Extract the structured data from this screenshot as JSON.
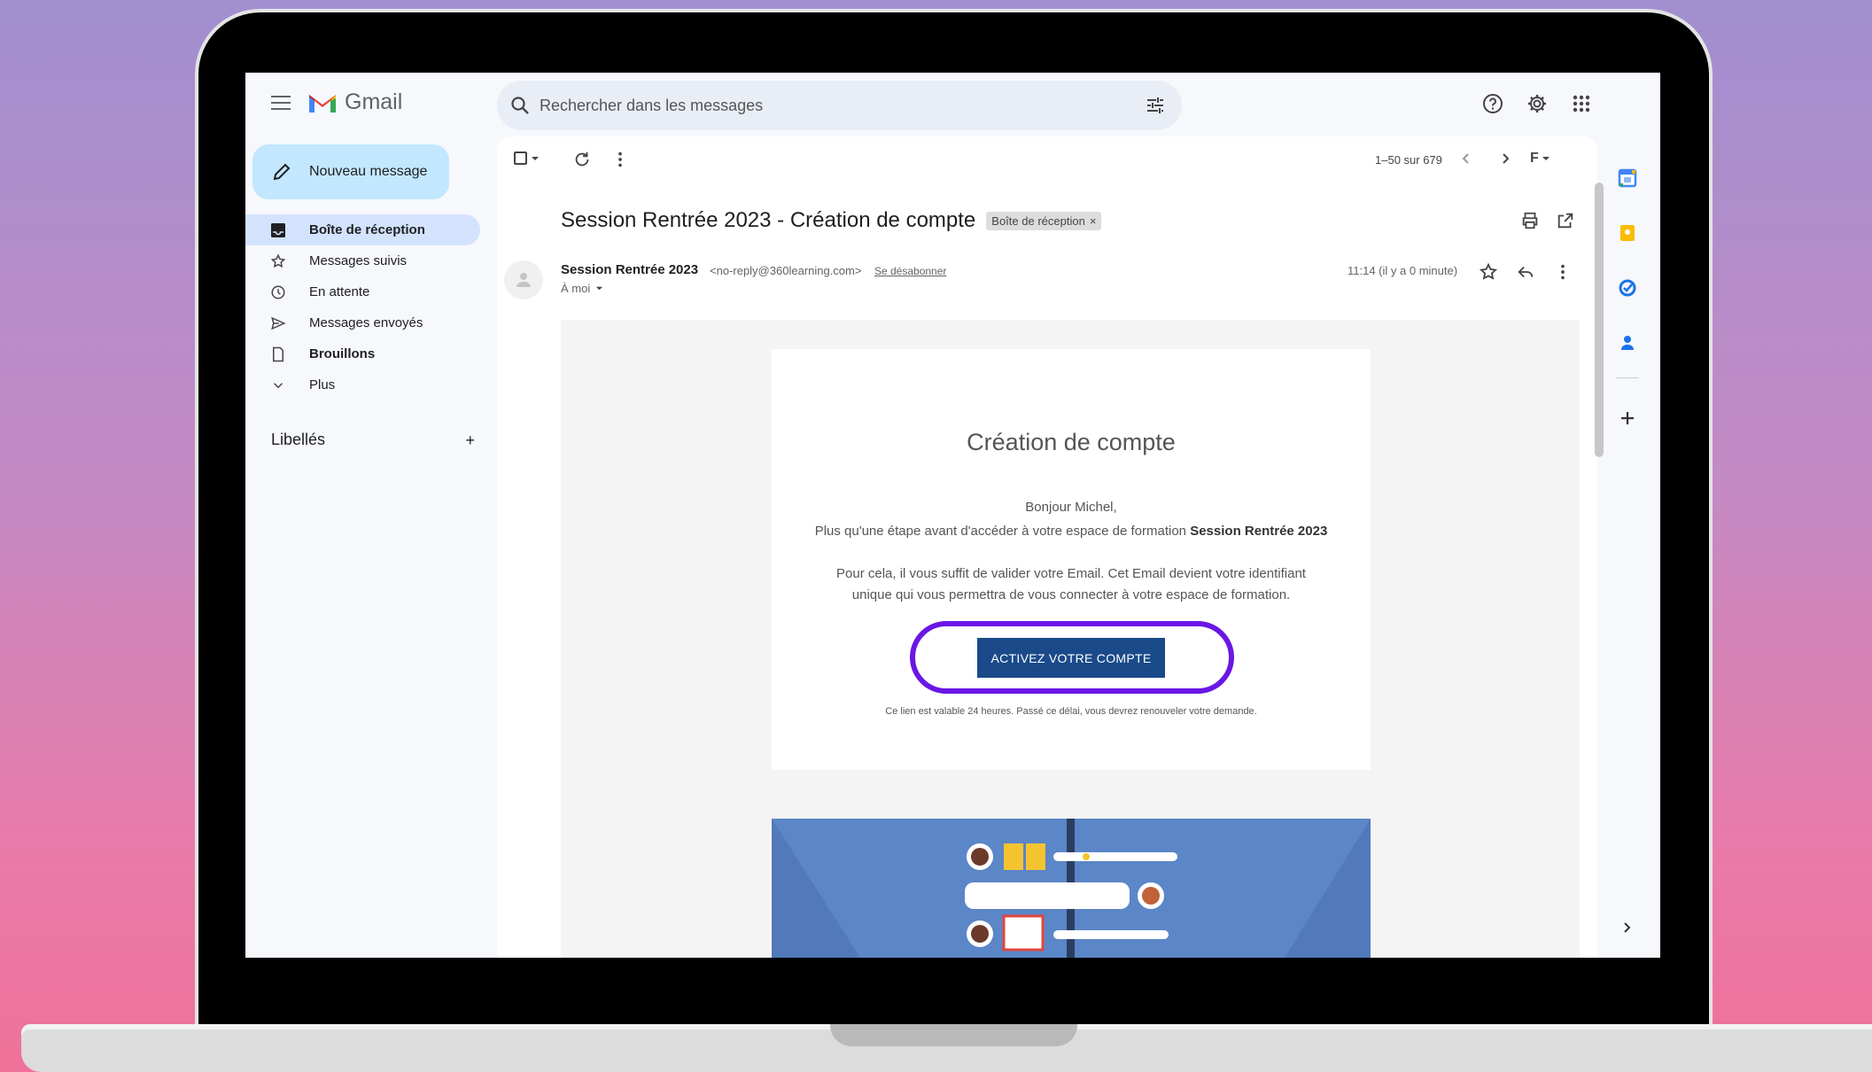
{
  "app": {
    "name": "Gmail"
  },
  "search": {
    "placeholder": "Rechercher dans les messages"
  },
  "compose": {
    "label": "Nouveau message"
  },
  "nav": {
    "items": [
      {
        "label": "Boîte de réception"
      },
      {
        "label": "Messages suivis"
      },
      {
        "label": "En attente"
      },
      {
        "label": "Messages envoyés"
      },
      {
        "label": "Brouillons"
      },
      {
        "label": "Plus"
      }
    ],
    "labels_heading": "Libellés"
  },
  "toolbar": {
    "pagecount": "1–50 sur 679",
    "lang": "F"
  },
  "message": {
    "subject": "Session Rentrée 2023 - Création de compte",
    "badge": "Boîte de réception",
    "sender_name": "Session Rentrée 2023",
    "sender_email": "<no-reply@360learning.com>",
    "unsubscribe": "Se désabonner",
    "to": "À moi",
    "time": "11:14 (il y a 0 minute)"
  },
  "email_body": {
    "heading": "Création de compte",
    "greeting": "Bonjour Michel,",
    "line1_prefix": "Plus qu'une étape avant d'accéder à votre espace de formation ",
    "line1_bold": "Session Rentrée 2023",
    "line2": "Pour cela, il vous suffit de valider votre Email. Cet Email devient votre identifiant unique qui vous permettra de vous connecter à votre espace de formation.",
    "cta": "ACTIVEZ VOTRE COMPTE",
    "validity": "Ce lien est valable 24 heures. Passé ce délai, vous devrez renouveler votre demande."
  },
  "colors": {
    "accent_ring": "#6a17e5",
    "cta": "#1a4a8a",
    "compose": "#c2e7ff",
    "nav_active": "#d3e3fd"
  },
  "icons": [
    "menu-icon",
    "gmail-logo-icon",
    "search-icon",
    "tune-icon",
    "help-icon",
    "settings-icon",
    "apps-icon",
    "pencil-icon",
    "inbox-icon",
    "star-icon",
    "clock-icon",
    "send-icon",
    "draft-icon",
    "chevron-down-icon",
    "plus-icon",
    "print-icon",
    "open-new-icon",
    "reply-icon",
    "more-vert-icon",
    "calendar-icon",
    "keep-icon",
    "tasks-icon",
    "contacts-icon"
  ]
}
